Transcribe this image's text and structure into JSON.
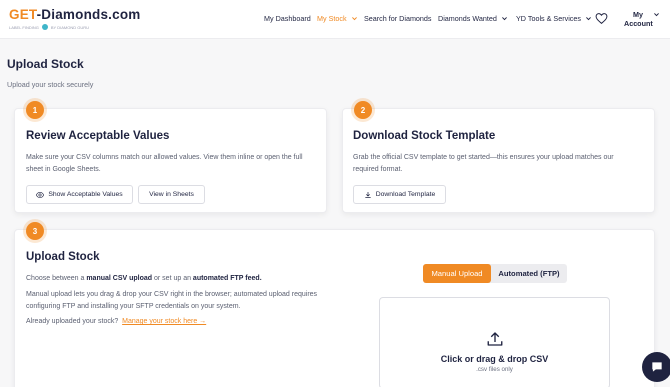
{
  "header": {
    "logo": {
      "brand": "GET-Diamonds.com",
      "brand_part1": "GET",
      "brand_part2": "-Diamonds.com",
      "tagline_left": "LABEL FINDING",
      "tagline_right": "BY DIAMOND GURU"
    },
    "nav": [
      {
        "label": "My Dashboard",
        "has_chevron": false,
        "active": false
      },
      {
        "label": "My Stock",
        "has_chevron": true,
        "active": true
      },
      {
        "label": "Search for Diamonds",
        "has_chevron": false,
        "active": false
      },
      {
        "label": "Diamonds Wanted",
        "has_chevron": true,
        "active": false
      },
      {
        "label": "YD Tools & Services",
        "has_chevron": true,
        "active": false
      }
    ],
    "wishlist_icon": "heart-icon",
    "account": {
      "line1": "My",
      "line2": "Account"
    }
  },
  "page": {
    "title": "Upload Stock",
    "subtitle": "Upload your stock securely"
  },
  "cards": {
    "review": {
      "step": "1",
      "title": "Review Acceptable Values",
      "description": "Make sure your CSV columns match our allowed values. View them inline or open the full sheet in Google Sheets.",
      "show_button": "Show Acceptable Values",
      "sheets_button": "View in Sheets"
    },
    "template": {
      "step": "2",
      "title": "Download Stock Template",
      "description": "Grab the official CSV template to get started—this ensures your upload matches our required format.",
      "download_button": "Download Template"
    },
    "upload": {
      "step": "3",
      "title": "Upload Stock",
      "intro_pre": "Choose between a ",
      "intro_bold1": "manual CSV upload",
      "intro_mid": " or set up an ",
      "intro_bold2": "automated FTP feed.",
      "detail": "Manual upload lets you drag & drop your CSV right in the browser; automated upload requires configuring FTP and installing your SFTP credentials on your system.",
      "already_text": "Already uploaded your stock?",
      "manage_link": "Manage your stock here →",
      "toggle": {
        "manual": "Manual Upload",
        "automated": "Automated (FTP)",
        "selected": "manual"
      },
      "dropzone": {
        "title": "Click or drag & drop CSV",
        "subtitle": ".csv files only"
      }
    }
  },
  "chat_icon": "chat-icon",
  "colors": {
    "accent": "#f08a24",
    "navy": "#1f2340",
    "muted": "#5a5f70"
  }
}
